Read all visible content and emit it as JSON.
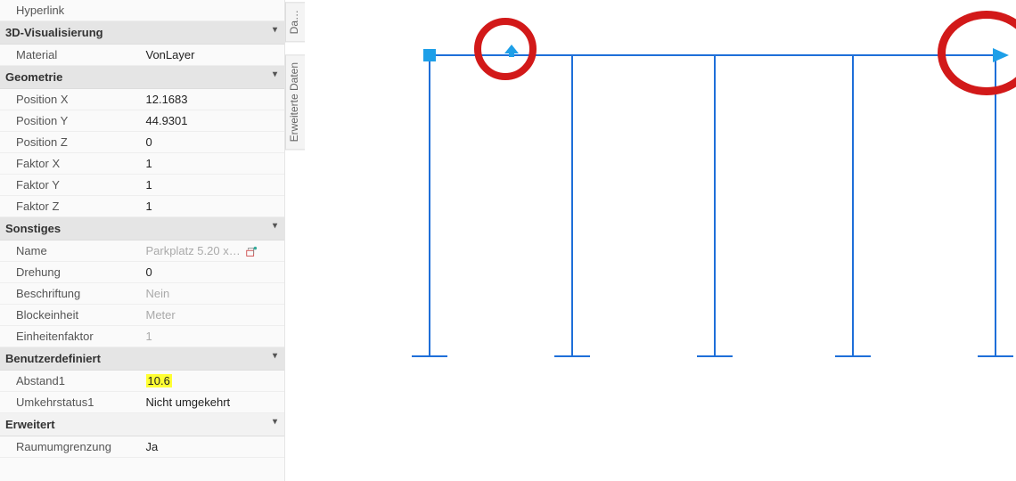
{
  "panel": {
    "topRow": {
      "label": "Hyperlink",
      "value": ""
    },
    "sections": [
      {
        "title": "3D-Visualisierung",
        "rows": [
          {
            "label": "Material",
            "value": "VonLayer"
          }
        ]
      },
      {
        "title": "Geometrie",
        "rows": [
          {
            "label": "Position X",
            "value": "12.1683"
          },
          {
            "label": "Position Y",
            "value": "44.9301"
          },
          {
            "label": "Position Z",
            "value": "0"
          },
          {
            "label": "Faktor X",
            "value": "1"
          },
          {
            "label": "Faktor Y",
            "value": "1"
          },
          {
            "label": "Faktor Z",
            "value": "1"
          }
        ]
      },
      {
        "title": "Sonstiges",
        "rows": [
          {
            "label": "Name",
            "value": "Parkplatz 5.20 x…",
            "muted": true,
            "editable": true
          },
          {
            "label": "Drehung",
            "value": "0"
          },
          {
            "label": "Beschriftung",
            "value": "Nein",
            "muted": true
          },
          {
            "label": "Blockeinheit",
            "value": "Meter",
            "muted": true
          },
          {
            "label": "Einheitenfaktor",
            "value": "1",
            "muted": true
          }
        ]
      },
      {
        "title": "Benutzerdefiniert",
        "rows": [
          {
            "label": "Abstand1",
            "value": "10.6",
            "highlight": true
          },
          {
            "label": "Umkehrstatus1",
            "value": "Nicht umgekehrt"
          }
        ]
      },
      {
        "title": "Erweitert",
        "rows": [
          {
            "label": "Raumumgrenzung",
            "value": "Ja"
          }
        ]
      }
    ]
  },
  "tabs": {
    "tab1": "Da…",
    "tab2": "Erweiterte Daten"
  },
  "drawing": {
    "strokeColor": "#1e6fd9",
    "gripColor": "#1e9fe8",
    "annotationColor": "#d21919"
  }
}
